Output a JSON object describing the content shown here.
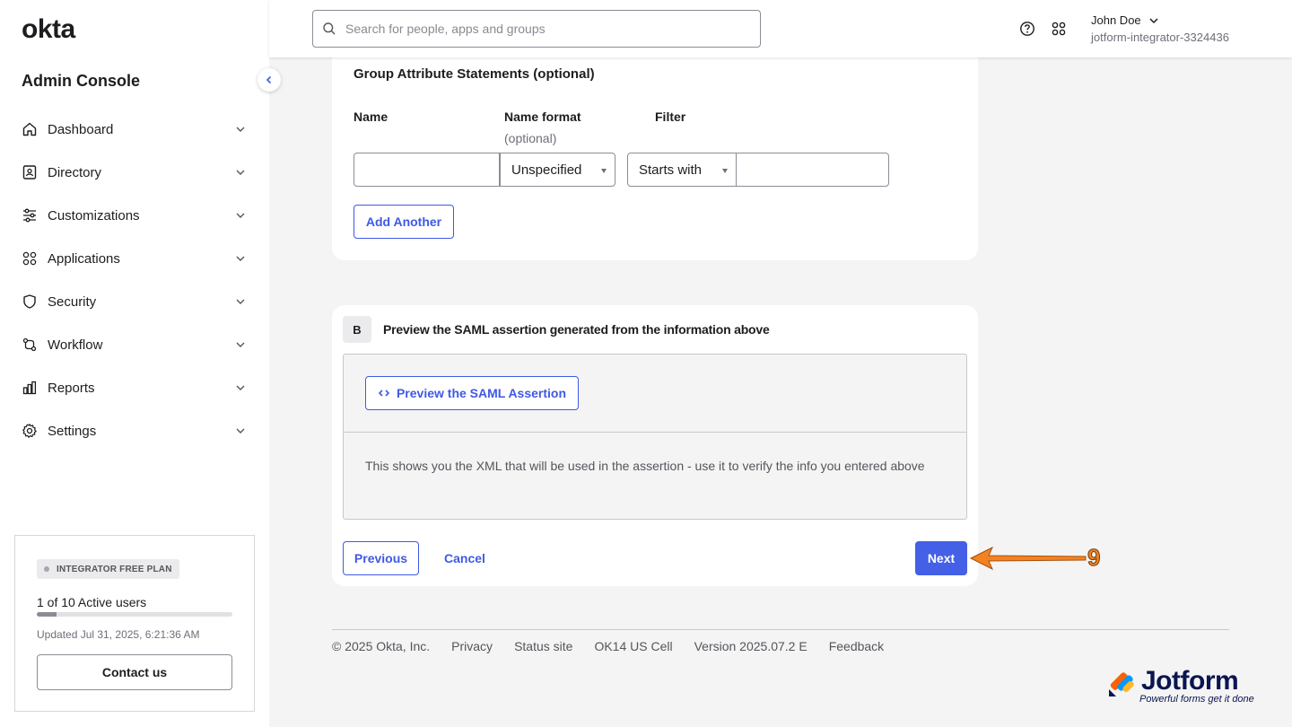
{
  "brand": {
    "logo_text": "okta",
    "console_title": "Admin Console"
  },
  "sidebar": {
    "items": [
      {
        "label": "Dashboard",
        "icon": "home-icon"
      },
      {
        "label": "Directory",
        "icon": "directory-icon"
      },
      {
        "label": "Customizations",
        "icon": "sliders-icon"
      },
      {
        "label": "Applications",
        "icon": "grid-icon"
      },
      {
        "label": "Security",
        "icon": "shield-icon"
      },
      {
        "label": "Workflow",
        "icon": "workflow-icon"
      },
      {
        "label": "Reports",
        "icon": "bar-chart-icon"
      },
      {
        "label": "Settings",
        "icon": "gear-icon"
      }
    ],
    "plan": {
      "badge": "INTEGRATOR FREE PLAN",
      "users": "1 of 10 Active users",
      "usage_fraction": 0.1,
      "updated": "Updated Jul 31, 2025, 6:21:36 AM",
      "contact_label": "Contact us"
    }
  },
  "header": {
    "search_placeholder": "Search for people, apps and groups",
    "user_name": "John Doe",
    "user_org": "jotform-integrator-3324436"
  },
  "group_attributes": {
    "title": "Group Attribute Statements (optional)",
    "col_name": "Name",
    "col_format": "Name format",
    "col_format_sub": "(optional)",
    "col_filter": "Filter",
    "name_value": "",
    "format_value": "Unspecified",
    "filter_type": "Starts with",
    "filter_value": "",
    "add_another_label": "Add Another"
  },
  "preview": {
    "step": "B",
    "title": "Preview the SAML assertion generated from the information above",
    "button_label": "Preview the SAML Assertion",
    "description": "This shows you the XML that will be used in the assertion - use it to verify the info you entered above"
  },
  "actions": {
    "previous": "Previous",
    "cancel": "Cancel",
    "next": "Next"
  },
  "annotation": {
    "step_number": "9",
    "color": "#f58220"
  },
  "footer": {
    "copyright": "© 2025 Okta, Inc.",
    "links": [
      "Privacy",
      "Status site",
      "OK14 US Cell",
      "Version 2025.07.2 E",
      "Feedback"
    ]
  },
  "watermark": {
    "name": "Jotform",
    "tagline": "Powerful forms get it done"
  },
  "colors": {
    "accent": "#3f59e4",
    "next_button": "#4360e6",
    "annotation": "#f58220"
  }
}
